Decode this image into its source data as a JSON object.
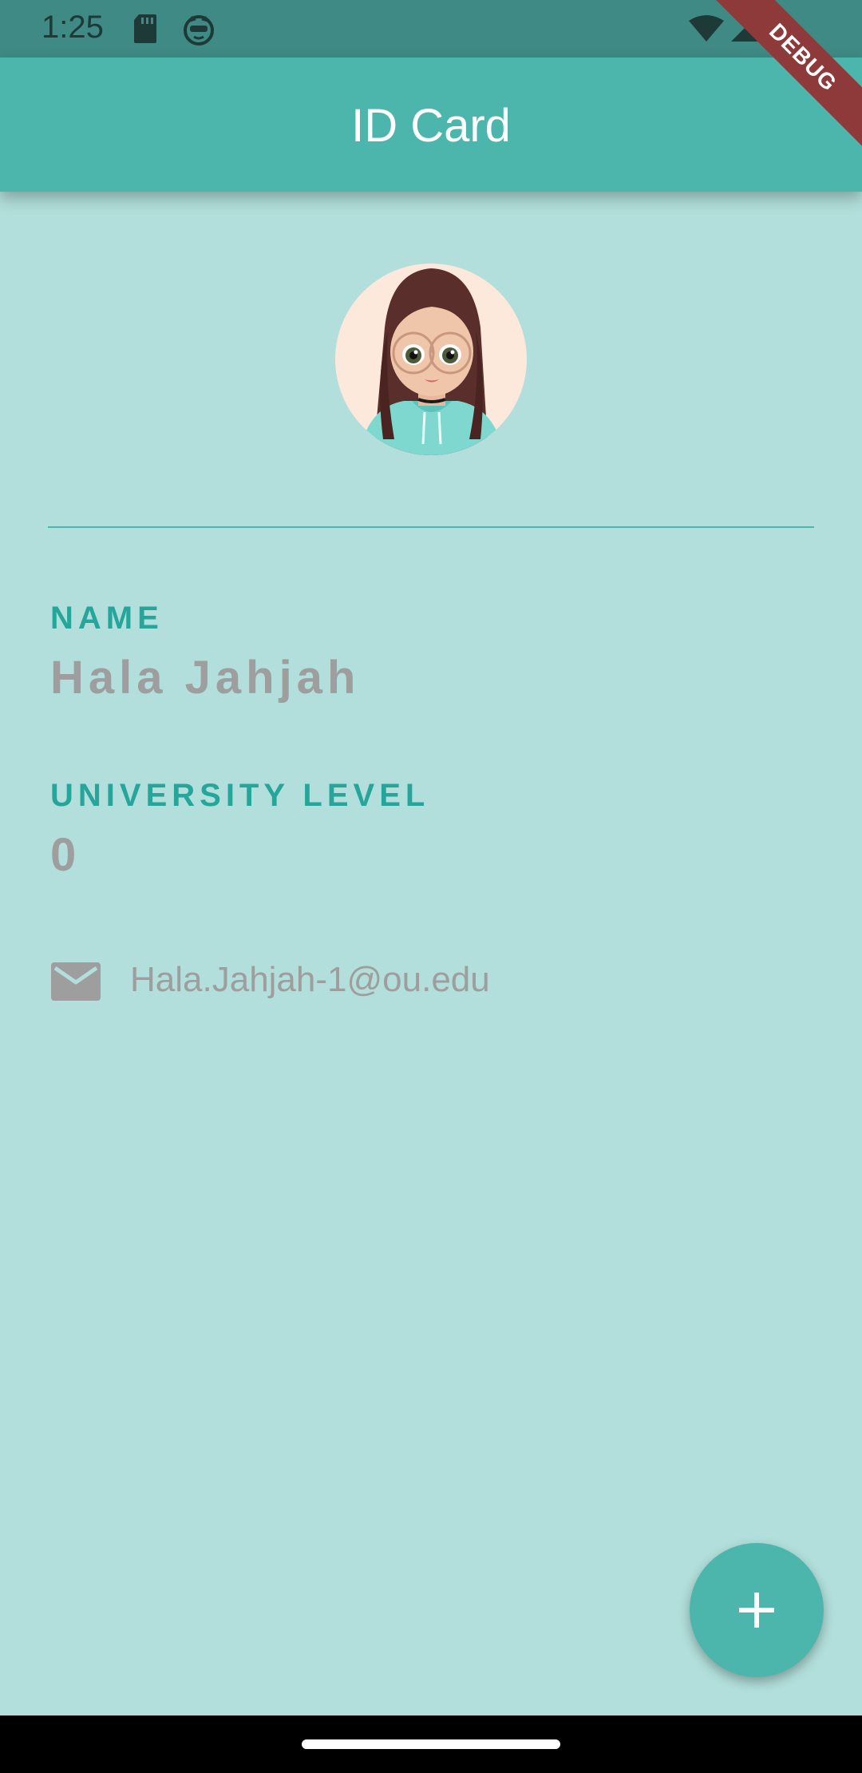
{
  "status_bar": {
    "time": "1:25",
    "icons": [
      "sd-card-icon",
      "cat-face-icon",
      "wifi-icon",
      "cell-signal-icon"
    ]
  },
  "debug_banner": "DEBUG",
  "app_bar": {
    "title": "ID Card"
  },
  "profile": {
    "name_label": "NAME",
    "name_value": "Hala Jahjah",
    "level_label": "UNIVERSITY LEVEL",
    "level_value": "0",
    "email": "Hala.Jahjah-1@ou.edu",
    "email_icon": "mail-icon"
  },
  "fab": {
    "icon": "plus-icon"
  },
  "colors": {
    "background": "#b2dfdb",
    "app_bar": "#4db6ac",
    "accent_text": "#26a69a",
    "value_text": "#9e9e9e"
  }
}
